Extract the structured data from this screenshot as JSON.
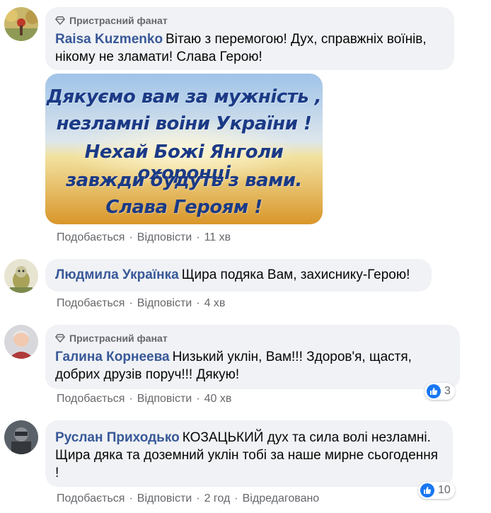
{
  "badge_label": "Пристрасний фанат",
  "comments": [
    {
      "author": "Raisa Kuzmenko",
      "text": "Вітаю з перемогою! Дух, справжніх воїнів, нікому не зламати! Слава Герою!",
      "has_badge": true,
      "image_lines": [
        "Дякуємо вам за мужність ,",
        "незламні воіни України !",
        "Нехай Божі Янголи охоронці",
        "завжди будуть з вами.",
        "Слава Героям !"
      ],
      "actions": {
        "like": "Подобається",
        "reply": "Відповісти",
        "time": "11 хв"
      }
    },
    {
      "author": "Людмила Українка",
      "text": "Щира подяка Вам, захиснику-Герою!",
      "actions": {
        "like": "Подобається",
        "reply": "Відповісти",
        "time": "4 хв"
      }
    },
    {
      "author": "Галина Корнеева",
      "text": "Низький уклін, Вам!!! Здоров'я, щастя, добрих друзів поруч!!! Дякую!",
      "has_badge": true,
      "reactions": "3",
      "actions": {
        "like": "Подобається",
        "reply": "Відповісти",
        "time": "40 хв"
      }
    },
    {
      "author": "Руслан Приходько",
      "text": "КОЗАЦЬКИЙ дух та сила волі незламні. Щира дяка та доземний уклін тобі за наше мирне сьогодення !",
      "reactions": "10",
      "actions": {
        "like": "Подобається",
        "reply": "Відповісти",
        "time": "2 год",
        "edited": "Відредаговано"
      }
    }
  ],
  "colors": {
    "author": "#385898",
    "bubble": "#f0f2f5",
    "meta": "#65676b",
    "like": "#1877f2"
  }
}
